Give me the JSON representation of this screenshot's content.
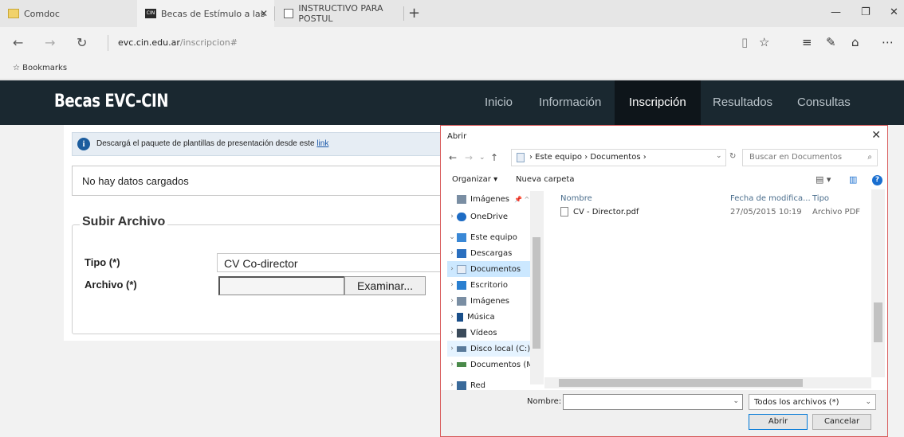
{
  "browser": {
    "tabs": [
      {
        "label": "Comdoc"
      },
      {
        "label": "Becas de Estímulo a las"
      },
      {
        "label": "INSTRUCTIVO PARA POSTUL"
      }
    ],
    "tab_favicon_text": "CIN",
    "tab_close": "✕",
    "new_tab": "+",
    "window_controls": {
      "minimize": "—",
      "restore": "❐",
      "close": "✕"
    },
    "nav": {
      "back": "←",
      "forward": "→",
      "refresh": "↻"
    },
    "url_host": "evc.cin.edu.ar",
    "url_path": "/inscripcion#",
    "toolbar_icons": {
      "reading": "▯",
      "favorite": "☆",
      "hub": "≡",
      "notes": "✎",
      "share": "⌂",
      "more": "⋯"
    },
    "bookmarks_label": "Bookmarks",
    "bookmarks_icon": "☆"
  },
  "site": {
    "brand": "Becas EVC-CIN",
    "nav": [
      {
        "label": "Inicio"
      },
      {
        "label": "Información"
      },
      {
        "label": "Inscripción"
      },
      {
        "label": "Resultados"
      },
      {
        "label": "Consultas"
      }
    ]
  },
  "page": {
    "info_icon": "i",
    "info_text": "Descargá el paquete de plantillas de presentación desde este ",
    "info_link": "link",
    "nodata": "No hay datos cargados",
    "legend": "Subir Archivo",
    "tipo_label": "Tipo (*)",
    "tipo_value": "CV Co-director",
    "archivo_label": "Archivo (*)",
    "browse_label": "Examinar..."
  },
  "dialog": {
    "title": "Abrir",
    "close": "✕",
    "nav": {
      "back": "←",
      "forward": "→",
      "recent": "⌄",
      "up": "↑"
    },
    "path": "›  Este equipo  ›  Documentos  ›",
    "path_dropdown": "⌄",
    "refresh": "↻",
    "search_placeholder": "Buscar en Documentos",
    "search_icon": "⌕",
    "organize": "Organizar ▾",
    "new_folder": "Nueva carpeta",
    "view_icon": "▤ ▾",
    "pane_icon": "▥",
    "help_icon": "?",
    "tree": [
      {
        "label": "Imágenes",
        "arrow": "",
        "pin": "📌 ^",
        "color": "#7a8ea3"
      },
      {
        "label": "OneDrive",
        "arrow": "›",
        "color": "#1e6cc4"
      },
      {
        "label": "Este equipo",
        "arrow": "⌄",
        "color": "#3a88d6"
      },
      {
        "label": "Descargas",
        "arrow": "›",
        "color": "#2a6fbf"
      },
      {
        "label": "Documentos",
        "arrow": "›",
        "color": "#8aa6c4"
      },
      {
        "label": "Escritorio",
        "arrow": "›",
        "color": "#2a7fd0"
      },
      {
        "label": "Imágenes",
        "arrow": "›",
        "color": "#7a8ea3"
      },
      {
        "label": "Música",
        "arrow": "›",
        "color": "#1a4f8a"
      },
      {
        "label": "Vídeos",
        "arrow": "›",
        "color": "#3a4a5a"
      },
      {
        "label": "Disco local (C:)",
        "arrow": "›",
        "color": "#5a7a9a"
      },
      {
        "label": "Documentos (M",
        "arrow": "›",
        "color": "#4a8a4a"
      },
      {
        "label": "Red",
        "arrow": "›",
        "color": "#3a6a9a"
      }
    ],
    "columns": {
      "name": "Nombre",
      "date": "Fecha de modifica...",
      "type": "Tipo"
    },
    "files": [
      {
        "name": "CV - Director.pdf",
        "date": "27/05/2015 10:19",
        "type": "Archivo PDF"
      }
    ],
    "name_label": "Nombre:",
    "name_value": "",
    "file_type": "Todos los archivos (*)",
    "dropdown": "⌄",
    "open_label": "Abrir",
    "cancel_label": "Cancelar"
  }
}
